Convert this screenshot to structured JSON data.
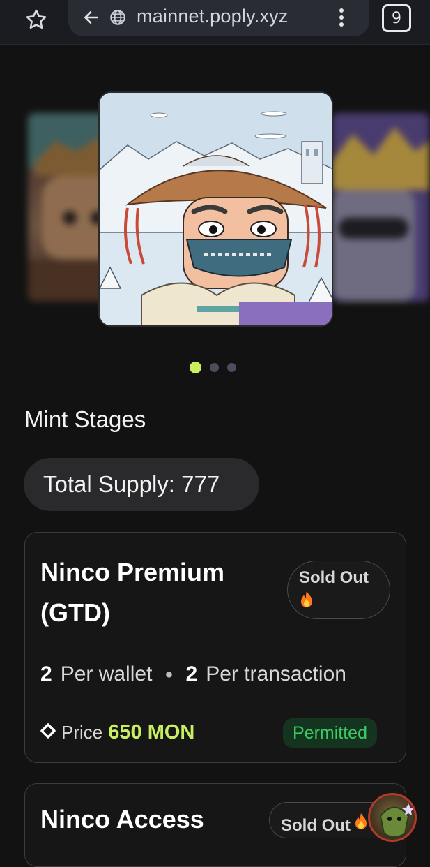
{
  "browser": {
    "url": "mainnet.poply.xyz",
    "tab_count": "9"
  },
  "carousel": {
    "slide_count": 3,
    "active_index": 0
  },
  "mint": {
    "section_title": "Mint Stages",
    "total_supply_label": "Total Supply: 777",
    "stages": [
      {
        "name": "Ninco Premium (GTD)",
        "status": "Sold Out",
        "per_wallet_count": "2",
        "per_wallet_label": "Per wallet",
        "per_tx_count": "2",
        "per_tx_label": "Per transaction",
        "price_label": "Price",
        "price_value": "650 MON",
        "eligibility": "Permitted"
      },
      {
        "name": "Ninco Access",
        "status": "Sold Out"
      }
    ]
  },
  "colors": {
    "accent": "#c8ef5f",
    "permitted_text": "#3ccb64",
    "permitted_bg": "#15341f",
    "background": "#121212"
  }
}
